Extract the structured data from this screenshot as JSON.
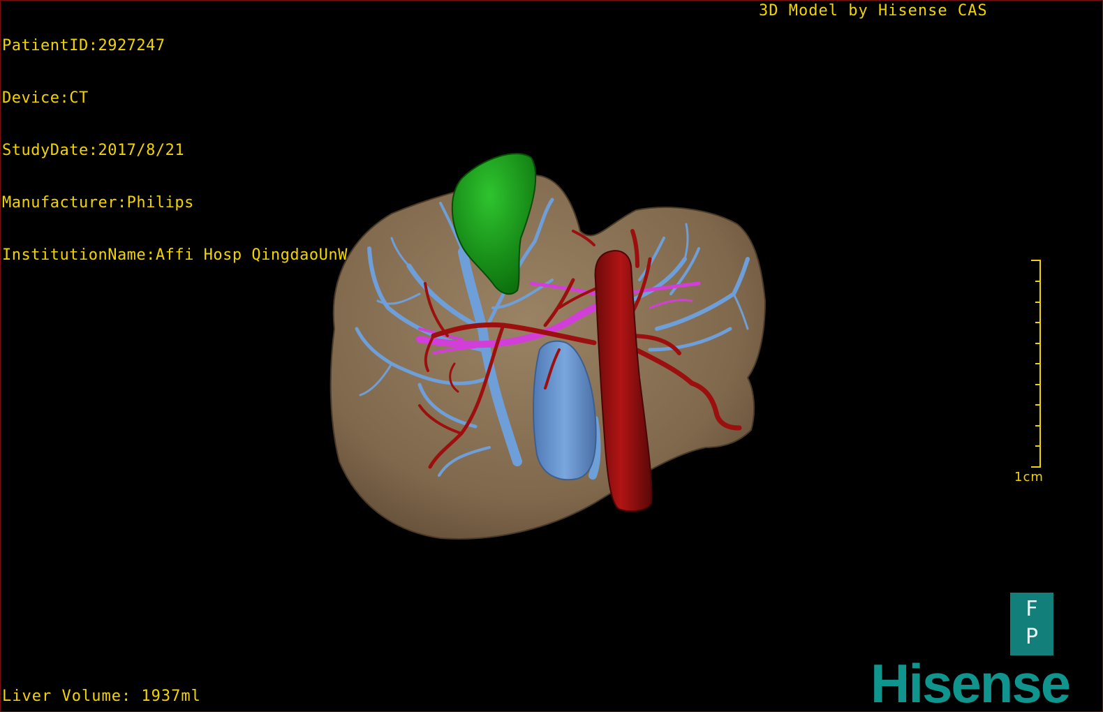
{
  "overlay": {
    "patient_id": "PatientID:2927247",
    "device": "Device:CT",
    "study_date": "StudyDate:2017/8/21",
    "manufacturer": "Manufacturer:Philips",
    "institution": "InstitutionName:Affi Hosp QingdaoUnW",
    "credit": "3D Model by Hisense CAS",
    "liver_volume": "Liver Volume: 1937ml"
  },
  "scale_bar": {
    "label": "1cm",
    "ticks": 11
  },
  "orientation": {
    "top": "F",
    "bottom": "P"
  },
  "logo": {
    "text": "Hisense"
  },
  "colors": {
    "overlay_text": "#f2d400",
    "liver": "#8a7256",
    "gallbladder": "#1a9a1a",
    "portal_vein": "#6f9fd9",
    "artery": "#9c0f0f",
    "biliary": "#d23fd8",
    "logo": "#0f958d"
  },
  "structures": [
    "liver",
    "gallbladder",
    "portal-vein",
    "hepatic-artery",
    "bile-duct"
  ]
}
